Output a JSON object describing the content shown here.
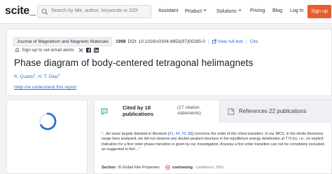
{
  "nav": {
    "logo": "scite_",
    "search_placeholder": "Search by title, author, keywords or DOI",
    "links": [
      "Assistant",
      "Product",
      "Solutions",
      "Pricing",
      "Blog",
      "Log In"
    ],
    "signup": "Sign up",
    "accent": "#ea5b2d",
    "icons": [
      "search-icon",
      "chevron-down-icon"
    ]
  },
  "paper": {
    "journal": "Journal of Magnetism and Magnetic Materials",
    "year": "1998",
    "doi": "DOI: 10.1016/s0304-8853(97)00285-0",
    "view_full_text": "View full text",
    "cite": "Cite",
    "alert": "Sign up to set email alerts",
    "title": "Phase diagram of body-centered tetragonal helimagnets",
    "authors": [
      {
        "name": "R. Quartu",
        "sup": "1"
      },
      {
        "name": "H. T. Diep",
        "sup": "2"
      }
    ],
    "help": "Help me understand this report",
    "link_color": "#2f6fd6"
  },
  "citations": {
    "cited_by": "Cited by 18 publications",
    "statements": "(17 citation statements)",
    "references": "References 22 publications"
  },
  "snippet": {
    "pre": "\"...An issue largely debated in literature [",
    "ref1": "41",
    "comma1": ", ",
    "ref2": "44",
    "comma2": ", ",
    "ref3": "50",
    "comma3": ", ",
    "ref4": "51",
    "close": "]",
    "post": " concerns the order of the chiral transition: In our MCS, in the whole thickness range here analyzed, we did not observe any double-peaked structure in the equilibrium energy distribution at T N (n), i.e., no explicit indication for a first order phase transition is given by our investigation. Anyway a first order transition can not be completely excluded, as suggested in Ref....\""
  },
  "footer": {
    "section_label": "Section:",
    "section": "B Global Film Properties",
    "contrasting": "contrasting",
    "confidence": "confidence: 58%"
  }
}
